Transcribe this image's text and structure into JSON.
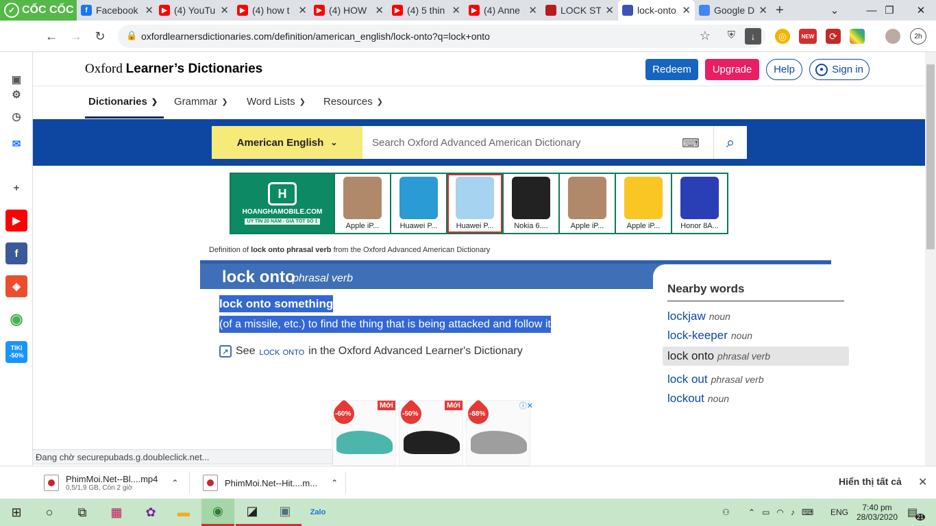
{
  "browser": {
    "brand": "CỐC CỐC",
    "tabs": [
      {
        "title": "Facebook",
        "favicon": "facebook-icon",
        "color": "#1877f2"
      },
      {
        "title": "(4) YouTu",
        "favicon": "youtube-icon",
        "color": "#ff0000"
      },
      {
        "title": "(4) how t",
        "favicon": "youtube-icon",
        "color": "#ff0000"
      },
      {
        "title": "(4) HOW",
        "favicon": "youtube-icon",
        "color": "#ff0000"
      },
      {
        "title": "(4) 5 thin",
        "favicon": "youtube-icon",
        "color": "#ff0000"
      },
      {
        "title": "(4) Anne",
        "favicon": "youtube-icon",
        "color": "#ff0000"
      },
      {
        "title": "LOCK STI",
        "favicon": "cambridge-icon",
        "color": "#b71c1c"
      },
      {
        "title": "lock-onto",
        "favicon": "oxford-icon",
        "color": "#3f51b5",
        "active": true
      },
      {
        "title": "Google D",
        "favicon": "google-translate-icon",
        "color": "#4285f4"
      }
    ],
    "new_tab": "+",
    "url": "oxfordlearnersdictionaries.com/definition/american_english/lock-onto?q=lock+onto",
    "status_text": "Đang chờ securepubads.g.doubleclick.net...",
    "ext_new_badge": "NEW",
    "profile_badge": "2h"
  },
  "sidebar": {
    "items": [
      {
        "icon": "panel-icon"
      },
      {
        "icon": "settings-icon"
      },
      {
        "icon": "history-icon"
      },
      {
        "icon": "messenger-icon"
      },
      {
        "icon": "add-icon"
      },
      {
        "icon": "youtube-icon",
        "color": "#ff0000"
      },
      {
        "icon": "facebook-icon",
        "color": "#3b5998"
      },
      {
        "icon": "shopee-icon",
        "color": "#ee4d2d"
      },
      {
        "icon": "coccoc-icon",
        "color": "#4caf50"
      },
      {
        "icon": "tiki-icon",
        "color": "#1a94ff",
        "label_top": "TIKI",
        "label_bottom": "-50%"
      }
    ]
  },
  "site": {
    "logo_serif": "Oxford",
    "logo_bold": "Learner’s Dictionaries",
    "redeem": "Redeem",
    "upgrade": "Upgrade",
    "help": "Help",
    "sign_in": "Sign in",
    "menu": [
      "Dictionaries",
      "Grammar",
      "Word Lists",
      "Resources"
    ],
    "dictionary_select": "American English",
    "search_placeholder": "Search Oxford Advanced American Dictionary",
    "colors": {
      "redeem": "#1565c0",
      "upgrade": "#e91e63",
      "band": "#0d47a1",
      "select": "#f5ea7a",
      "headbar": "#3f6fb6"
    }
  },
  "ad_banner": {
    "brand": "HOANGHAMOBILE.COM",
    "tagline": "UY TÍN 20 NĂM - GIÁ TỐT SỐ 1",
    "phones": [
      "Apple iP...",
      "Huawei P...",
      "Huawei P...",
      "Nokia 6....",
      "Apple iP...",
      "Apple iP...",
      "Honor 8A..."
    ]
  },
  "entry": {
    "def_prefix": "Definition of ",
    "def_term": "lock onto phrasal verb",
    "def_suffix": " from the Oxford Advanced American Dictionary",
    "headword": "lock onto",
    "pos": "phrasal verb",
    "sense_usage": "lock onto something",
    "sense_def": "(of a missile, etc.) to find the thing that is being attacked and follow it",
    "see_prefix": "See",
    "see_link": "lock onto",
    "see_suffix": "in the Oxford Advanced Learner's Dictionary"
  },
  "nearby": {
    "title": "Nearby words",
    "items": [
      {
        "word": "lockjaw",
        "pos": "noun"
      },
      {
        "word": "lock-keeper",
        "pos": "noun"
      },
      {
        "word": "lock onto",
        "pos": "phrasal verb",
        "current": true
      },
      {
        "word": "lock out",
        "pos": "phrasal verb"
      },
      {
        "word": "lockout",
        "pos": "noun"
      }
    ]
  },
  "ad_bottom": {
    "items": [
      {
        "discount": "-60%",
        "badge": "Mới",
        "color": "#4db6ac"
      },
      {
        "discount": "-50%",
        "badge": "Mới",
        "color": "#212121"
      },
      {
        "discount": "-88%",
        "badge": "",
        "color": "#9e9e9e"
      }
    ]
  },
  "downloads": {
    "items": [
      {
        "name": "PhimMoi.Net--Bl....mp4",
        "sub": "0,5/1,9 GB, Còn 2 giờ"
      },
      {
        "name": "PhimMoi.Net--Hit....m...",
        "sub": ""
      }
    ],
    "show_all": "Hiển thị tất cả"
  },
  "taskbar": {
    "language": "ENG",
    "time": "7:40 pm",
    "date": "28/03/2020",
    "notifications": "21"
  }
}
